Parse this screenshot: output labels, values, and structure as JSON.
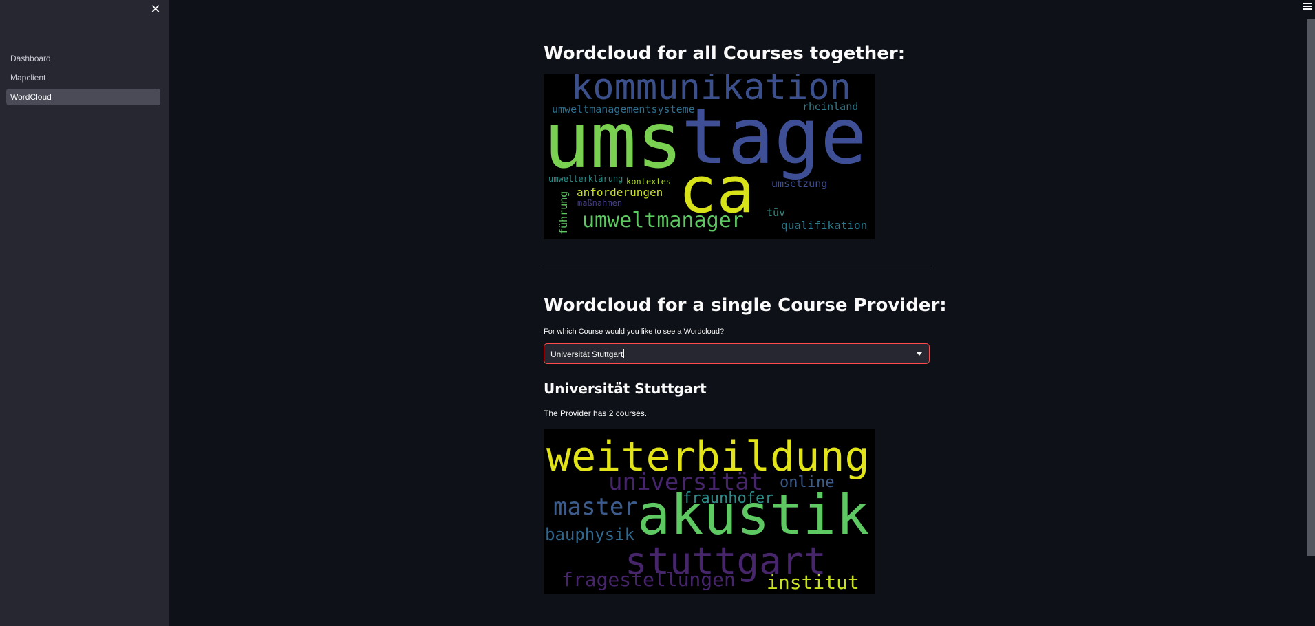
{
  "sidebar": {
    "close_icon": "close-icon",
    "items": [
      {
        "label": "Dashboard",
        "active": false
      },
      {
        "label": "Mapclient",
        "active": false
      },
      {
        "label": "WordCloud",
        "active": true
      }
    ]
  },
  "header": {
    "menu_icon": "hamburger-menu-icon"
  },
  "section_all": {
    "title": "Wordcloud for all Courses together:",
    "wordcloud": {
      "background": "#000000",
      "words": [
        {
          "text": "kommunikation",
          "color": "#3b4f8a"
        },
        {
          "text": "umwelt­managementsysteme",
          "color": "#2f6f8e"
        },
        {
          "text": "rheinland",
          "color": "#2d7b8a"
        },
        {
          "text": "ums",
          "color": "#7ad151"
        },
        {
          "text": "tage",
          "color": "#3e4f96"
        },
        {
          "text": "ca",
          "color": "#d8e219"
        },
        {
          "text": "umwelterklärung",
          "color": "#2a8d87"
        },
        {
          "text": "kontextes",
          "color": "#b5de2b"
        },
        {
          "text": "umsetzung",
          "color": "#3e4f96"
        },
        {
          "text": "anforderungen",
          "color": "#c8e020"
        },
        {
          "text": "maßnahmen",
          "color": "#433e85"
        },
        {
          "text": "führung",
          "color": "#5ec962"
        },
        {
          "text": "umweltmanager",
          "color": "#5ec962"
        },
        {
          "text": "tüv",
          "color": "#2e8b7e"
        },
        {
          "text": "qualifikation",
          "color": "#2a7a8e"
        }
      ]
    }
  },
  "section_single": {
    "title": "Wordcloud for a single Course Provider:",
    "select_label": "For which Course would you like to see a Wordcloud?",
    "select_value": "Universität Stuttgart",
    "provider_title": "Universität Stuttgart",
    "provider_info": "The Provider has 2 courses.",
    "wordcloud": {
      "background": "#000000",
      "words": [
        {
          "text": "weiterbildung",
          "color": "#e2e418"
        },
        {
          "text": "universität",
          "color": "#46256b"
        },
        {
          "text": "online",
          "color": "#3b5c8c"
        },
        {
          "text": "fraunhofer",
          "color": "#2a8a87"
        },
        {
          "text": "master",
          "color": "#3b5c8c"
        },
        {
          "text": "akustik",
          "color": "#5ec962"
        },
        {
          "text": "bauphysik",
          "color": "#31688e"
        },
        {
          "text": "stuttgart",
          "color": "#46256b"
        },
        {
          "text": "fragestellungen",
          "color": "#46256b"
        },
        {
          "text": "institut",
          "color": "#c8e020"
        }
      ]
    }
  }
}
